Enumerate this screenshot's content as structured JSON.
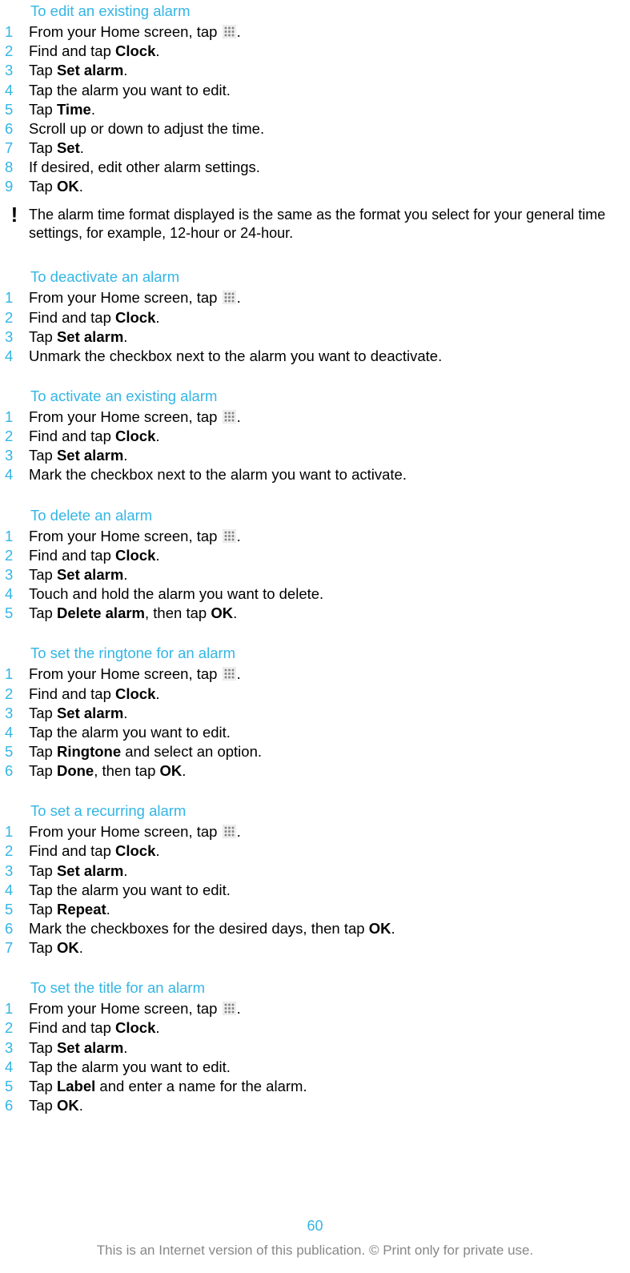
{
  "sections": [
    {
      "title": "To edit an existing alarm",
      "steps": [
        {
          "n": "1",
          "parts": [
            "From your Home screen, tap ",
            "[APPS]",
            "."
          ]
        },
        {
          "n": "2",
          "parts": [
            "Find and tap ",
            "<b>Clock</b>",
            "."
          ]
        },
        {
          "n": "3",
          "parts": [
            "Tap ",
            "<b>Set alarm</b>",
            "."
          ]
        },
        {
          "n": "4",
          "parts": [
            "Tap the alarm you want to edit."
          ]
        },
        {
          "n": "5",
          "parts": [
            "Tap ",
            "<b>Time</b>",
            "."
          ]
        },
        {
          "n": "6",
          "parts": [
            "Scroll up or down to adjust the time."
          ]
        },
        {
          "n": "7",
          "parts": [
            "Tap ",
            "<b>Set</b>",
            "."
          ]
        },
        {
          "n": "8",
          "parts": [
            "If desired, edit other alarm settings."
          ]
        },
        {
          "n": "9",
          "parts": [
            "Tap ",
            "<b>OK</b>",
            "."
          ]
        }
      ],
      "note": "The alarm time format displayed is the same as the format you select for your general time settings, for example, 12-hour or 24-hour."
    },
    {
      "title": "To deactivate an alarm",
      "steps": [
        {
          "n": "1",
          "parts": [
            "From your Home screen, tap ",
            "[APPS]",
            "."
          ]
        },
        {
          "n": "2",
          "parts": [
            "Find and tap ",
            "<b>Clock</b>",
            "."
          ]
        },
        {
          "n": "3",
          "parts": [
            "Tap ",
            "<b>Set alarm</b>",
            "."
          ]
        },
        {
          "n": "4",
          "parts": [
            "Unmark the checkbox next to the alarm you want to deactivate."
          ]
        }
      ]
    },
    {
      "title": "To activate an existing alarm",
      "steps": [
        {
          "n": "1",
          "parts": [
            "From your Home screen, tap ",
            "[APPS]",
            "."
          ]
        },
        {
          "n": "2",
          "parts": [
            "Find and tap ",
            "<b>Clock</b>",
            "."
          ]
        },
        {
          "n": "3",
          "parts": [
            "Tap ",
            "<b>Set alarm</b>",
            "."
          ]
        },
        {
          "n": "4",
          "parts": [
            "Mark the checkbox next to the alarm you want to activate."
          ]
        }
      ]
    },
    {
      "title": "To delete an alarm",
      "steps": [
        {
          "n": "1",
          "parts": [
            "From your Home screen, tap ",
            "[APPS]",
            "."
          ]
        },
        {
          "n": "2",
          "parts": [
            "Find and tap ",
            "<b>Clock</b>",
            "."
          ]
        },
        {
          "n": "3",
          "parts": [
            "Tap ",
            "<b>Set alarm</b>",
            "."
          ]
        },
        {
          "n": "4",
          "parts": [
            "Touch and hold the alarm you want to delete."
          ]
        },
        {
          "n": "5",
          "parts": [
            "Tap ",
            "<b>Delete alarm</b>",
            ", then tap ",
            "<b>OK</b>",
            "."
          ]
        }
      ]
    },
    {
      "title": "To set the ringtone for an alarm",
      "steps": [
        {
          "n": "1",
          "parts": [
            "From your Home screen, tap ",
            "[APPS]",
            "."
          ]
        },
        {
          "n": "2",
          "parts": [
            "Find and tap ",
            "<b>Clock</b>",
            "."
          ]
        },
        {
          "n": "3",
          "parts": [
            "Tap ",
            "<b>Set alarm</b>",
            "."
          ]
        },
        {
          "n": "4",
          "parts": [
            "Tap the alarm you want to edit."
          ]
        },
        {
          "n": "5",
          "parts": [
            "Tap ",
            "<b>Ringtone</b>",
            " and select an option."
          ]
        },
        {
          "n": "6",
          "parts": [
            "Tap ",
            "<b>Done</b>",
            ", then tap ",
            "<b>OK</b>",
            "."
          ]
        }
      ]
    },
    {
      "title": "To set a recurring alarm",
      "steps": [
        {
          "n": "1",
          "parts": [
            "From your Home screen, tap ",
            "[APPS]",
            "."
          ]
        },
        {
          "n": "2",
          "parts": [
            "Find and tap ",
            "<b>Clock</b>",
            "."
          ]
        },
        {
          "n": "3",
          "parts": [
            "Tap ",
            "<b>Set alarm</b>",
            "."
          ]
        },
        {
          "n": "4",
          "parts": [
            "Tap the alarm you want to edit."
          ]
        },
        {
          "n": "5",
          "parts": [
            "Tap ",
            "<b>Repeat</b>",
            "."
          ]
        },
        {
          "n": "6",
          "parts": [
            "Mark the checkboxes for the desired days, then tap ",
            "<b>OK</b>",
            "."
          ]
        },
        {
          "n": "7",
          "parts": [
            "Tap ",
            "<b>OK</b>",
            "."
          ]
        }
      ]
    },
    {
      "title": "To set the title for an alarm",
      "steps": [
        {
          "n": "1",
          "parts": [
            "From your Home screen, tap ",
            "[APPS]",
            "."
          ]
        },
        {
          "n": "2",
          "parts": [
            "Find and tap ",
            "<b>Clock</b>",
            "."
          ]
        },
        {
          "n": "3",
          "parts": [
            "Tap ",
            "<b>Set alarm</b>",
            "."
          ]
        },
        {
          "n": "4",
          "parts": [
            "Tap the alarm you want to edit."
          ]
        },
        {
          "n": "5",
          "parts": [
            "Tap ",
            "<b>Label</b>",
            " and enter a name for the alarm."
          ]
        },
        {
          "n": "6",
          "parts": [
            "Tap ",
            "<b>OK</b>",
            "."
          ]
        }
      ]
    }
  ],
  "page_number": "60",
  "footer": "This is an Internet version of this publication. © Print only for private use."
}
